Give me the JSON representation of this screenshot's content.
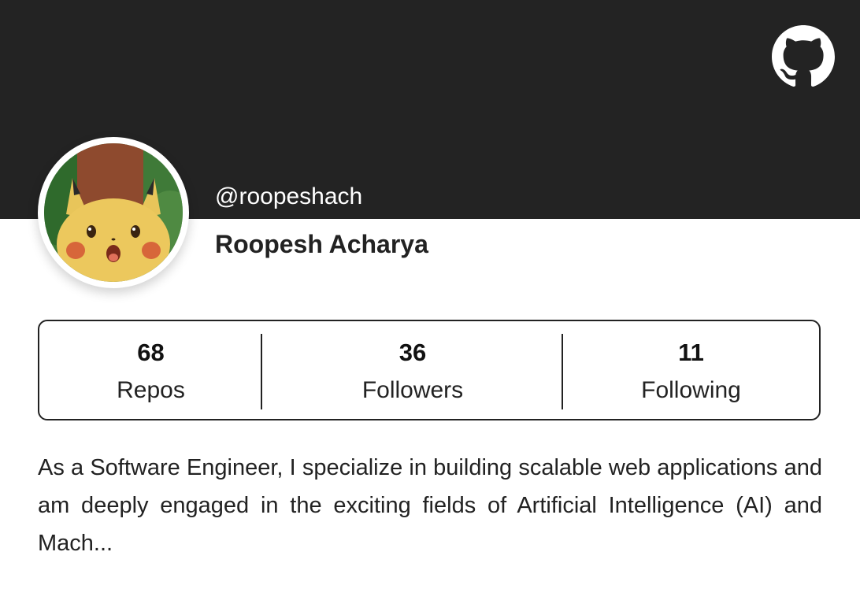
{
  "profile": {
    "handle": "@roopeshach",
    "name": "Roopesh Acharya",
    "avatar_icon": "pikachu-surprised-avatar",
    "github_icon": "github-octocat-icon"
  },
  "stats": {
    "repos": {
      "count": "68",
      "label": "Repos"
    },
    "followers": {
      "count": "36",
      "label": "Followers"
    },
    "following": {
      "count": "11",
      "label": "Following"
    }
  },
  "bio": "As a Software Engineer, I specialize in building scalable web applications and am deeply engaged in the exciting fields of Artificial Intelligence (AI) and Mach...",
  "colors": {
    "banner": "#232323",
    "card": "#ffffff",
    "text": "#222222",
    "border": "#222222"
  }
}
